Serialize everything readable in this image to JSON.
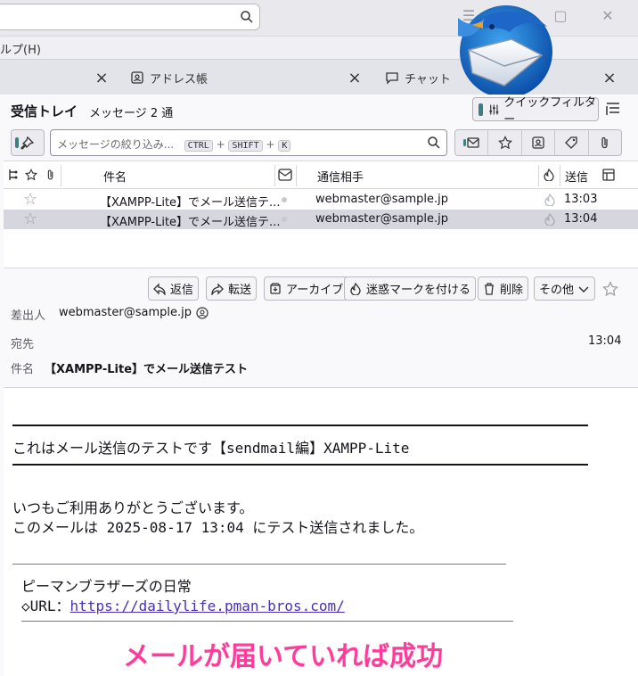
{
  "menubar": {
    "help_fragment": "ルプ(H)"
  },
  "tabs": [
    {
      "label": "アドレス帳"
    },
    {
      "label": "チャット"
    }
  ],
  "folder": {
    "title": "受信トレイ",
    "count": "メッセージ 2 通",
    "quick_filter_label": "クイックフィルター"
  },
  "filter": {
    "placeholder": "メッセージの絞り込み...",
    "shortcut_keys": [
      "CTRL",
      "SHIFT",
      "K"
    ],
    "plus": "+"
  },
  "columns": {
    "subject": "件名",
    "correspondent": "通信相手",
    "date": "送信"
  },
  "messages": [
    {
      "subject": "【XAMPP-Lite】でメール送信テ...",
      "from": "webmaster@sample.jp",
      "date": "13:03"
    },
    {
      "subject": "【XAMPP-Lite】でメール送信テ...",
      "from": "webmaster@sample.jp",
      "date": "13:04"
    }
  ],
  "message_header": {
    "buttons": {
      "reply": "返信",
      "forward": "転送",
      "archive": "アーカイブ",
      "junk": "迷惑マークを付ける",
      "delete": "削除",
      "more": "その他"
    },
    "from_label": "差出人",
    "from_value": "webmaster@sample.jp",
    "to_label": "宛先",
    "time": "13:04",
    "subject_label": "件名",
    "subject_value": "【XAMPP-Lite】でメール送信テスト"
  },
  "body": {
    "heading": "これはメール送信のテストです【sendmail編】XAMPP-Lite",
    "line1": "いつもご利用ありがとうございます。",
    "line2": "このメールは 2025-08-17 13:04 にテスト送信されました。",
    "signature_name": "ピーマンブラザーズの日常",
    "signature_url_label": "◇URL：",
    "signature_url": "https://dailylife.pman-bros.com/"
  },
  "overlay_caption": "メールが届いていれば成功",
  "colors": {
    "accent_teal": "#3d7f80",
    "overlay_pink": "#ff3c9a",
    "selected_row": "#d6d6de",
    "link": "#4a2fb8"
  }
}
